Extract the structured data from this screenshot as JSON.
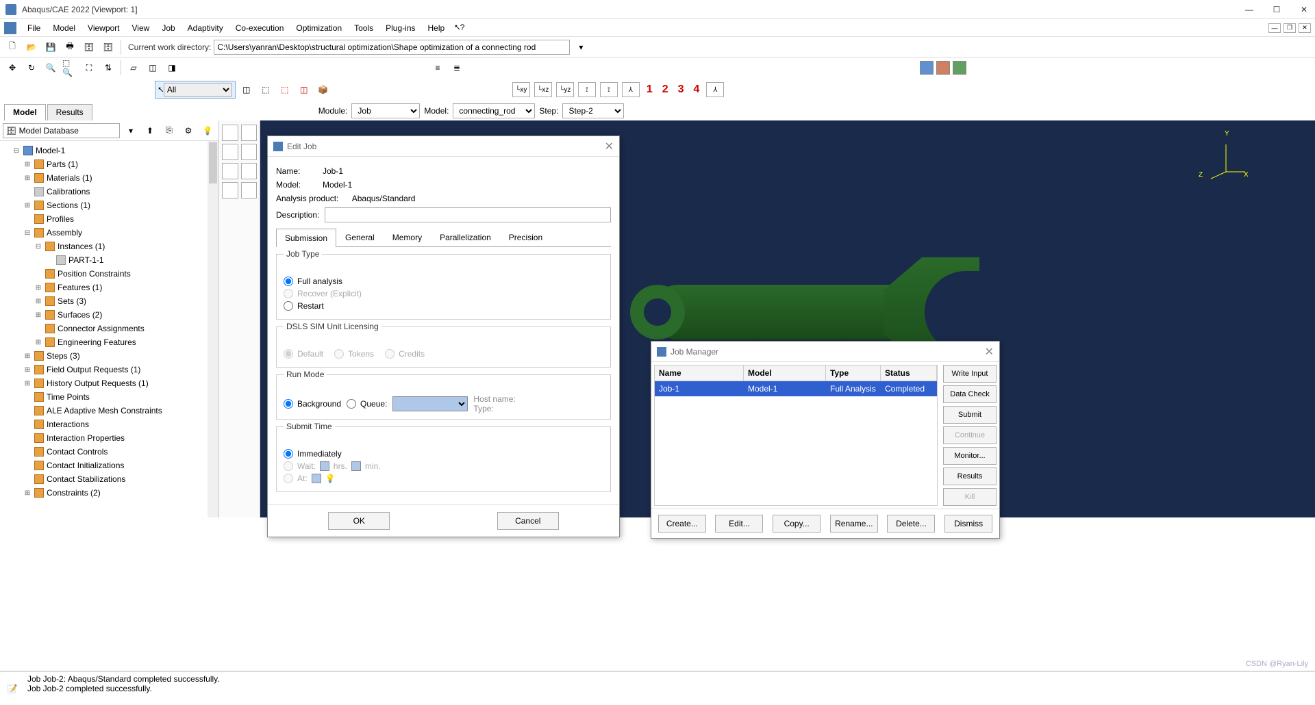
{
  "window": {
    "title": "Abaqus/CAE 2022 [Viewport: 1]"
  },
  "menubar": [
    "File",
    "Model",
    "Viewport",
    "View",
    "Job",
    "Adaptivity",
    "Co-execution",
    "Optimization",
    "Tools",
    "Plug-ins",
    "Help"
  ],
  "cwd": {
    "label": "Current work directory:",
    "value": "C:\\Users\\yanran\\Desktop\\structural optimization\\Shape optimization of a connecting rod"
  },
  "allselector": "All",
  "csys_numbers": [
    "1",
    "2",
    "3",
    "4"
  ],
  "context": {
    "module_label": "Module:",
    "module": "Job",
    "model_label": "Model:",
    "model": "connecting_rod",
    "step_label": "Step:",
    "step": "Step-2"
  },
  "left_tabs": [
    "Model",
    "Results"
  ],
  "db_selector": "Model Database",
  "tree": {
    "root": "Model-1",
    "items": [
      "Parts (1)",
      "Materials (1)",
      "Calibrations",
      "Sections (1)",
      "Profiles",
      "Assembly",
      "Instances (1)",
      "PART-1-1",
      "Position Constraints",
      "Features (1)",
      "Sets (3)",
      "Surfaces (2)",
      "Connector Assignments",
      "Engineering Features",
      "Steps (3)",
      "Field Output Requests (1)",
      "History Output Requests (1)",
      "Time Points",
      "ALE Adaptive Mesh Constraints",
      "Interactions",
      "Interaction Properties",
      "Contact Controls",
      "Contact Initializations",
      "Contact Stabilizations",
      "Constraints (2)"
    ]
  },
  "editjob": {
    "title": "Edit Job",
    "name_label": "Name:",
    "name": "Job-1",
    "model_label": "Model:",
    "model": "Model-1",
    "product_label": "Analysis product:",
    "product": "Abaqus/Standard",
    "desc_label": "Description:",
    "tabs": [
      "Submission",
      "General",
      "Memory",
      "Parallelization",
      "Precision"
    ],
    "jobtype": {
      "legend": "Job Type",
      "full": "Full analysis",
      "recover": "Recover (Explicit)",
      "restart": "Restart"
    },
    "licensing": {
      "legend": "DSLS SIM Unit Licensing",
      "default": "Default",
      "tokens": "Tokens",
      "credits": "Credits"
    },
    "runmode": {
      "legend": "Run Mode",
      "background": "Background",
      "queue": "Queue:",
      "hostname": "Host name:",
      "type": "Type:"
    },
    "submittime": {
      "legend": "Submit Time",
      "immediately": "Immediately",
      "wait": "Wait:",
      "hrs": "hrs.",
      "min": "min.",
      "at": "At:"
    },
    "ok": "OK",
    "cancel": "Cancel"
  },
  "jobmgr": {
    "title": "Job Manager",
    "headers": [
      "Name",
      "Model",
      "Type",
      "Status"
    ],
    "row": [
      "Job-1",
      "Model-1",
      "Full Analysis",
      "Completed"
    ],
    "side_buttons": [
      "Write Input",
      "Data Check",
      "Submit",
      "Continue",
      "Monitor...",
      "Results",
      "Kill"
    ],
    "foot_buttons": [
      "Create...",
      "Edit...",
      "Copy...",
      "Rename...",
      "Delete...",
      "Dismiss"
    ]
  },
  "messages": {
    "line1": "Job Job-2: Abaqus/Standard completed successfully.",
    "line2": "Job Job-2 completed successfully."
  },
  "watermark": "CSDN @Ryan-Lily"
}
